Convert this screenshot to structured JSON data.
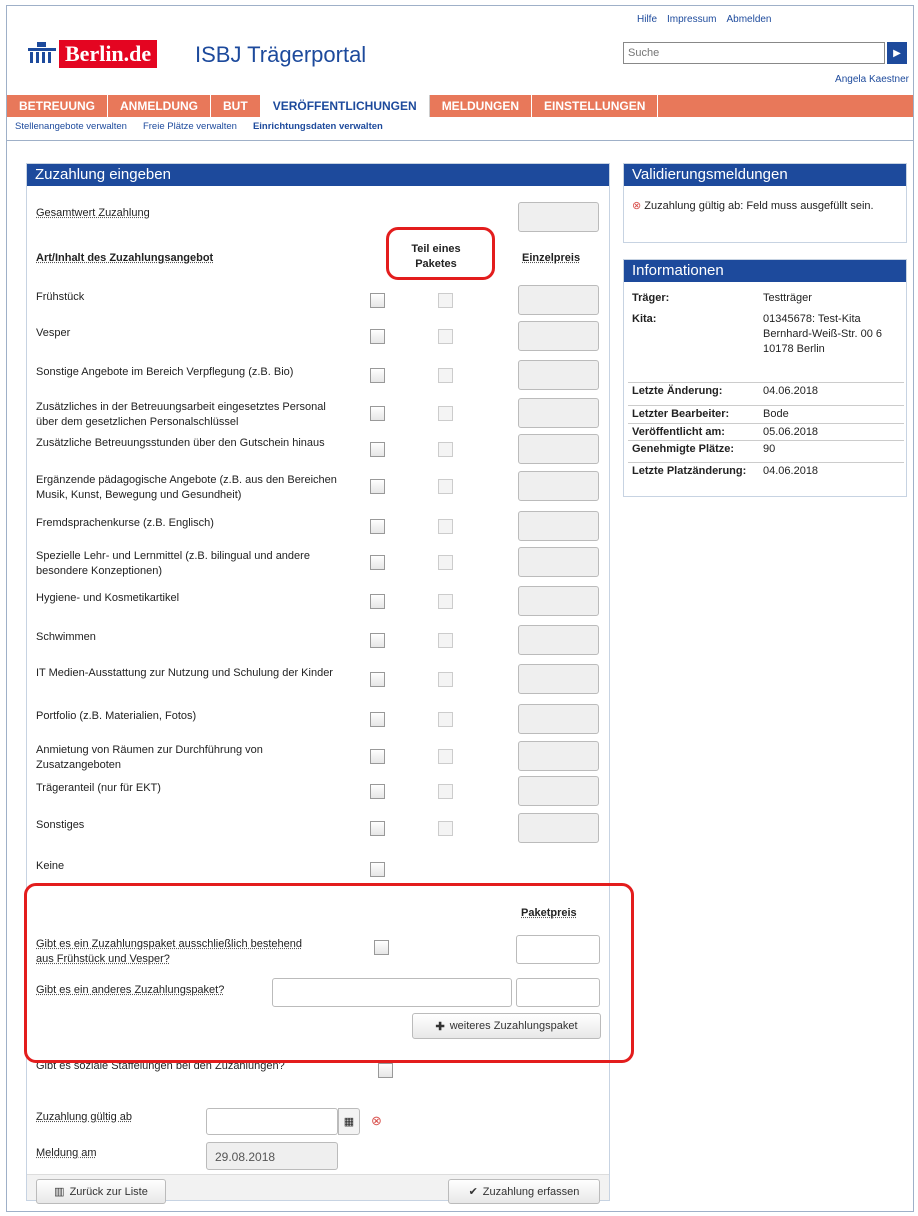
{
  "header": {
    "logo_text": "Berlin",
    "logo_de": ".de",
    "title": "ISBJ Trägerportal",
    "links": [
      "Hilfe",
      "Impressum",
      "Abmelden"
    ],
    "search_placeholder": "Suche",
    "user": "Angela Kaestner"
  },
  "nav": {
    "items": [
      "BETREUUNG",
      "ANMELDUNG",
      "BUT",
      "VERÖFFENTLICHUNGEN",
      "MELDUNGEN",
      "EINSTELLUNGEN"
    ],
    "active": "VERÖFFENTLICHUNGEN",
    "sub": [
      "Stellenangebote verwalten",
      "Freie Plätze verwalten",
      "Einrichtungsdaten verwalten"
    ]
  },
  "form": {
    "title": "Zuzahlung eingeben",
    "gesamtwert": "Gesamtwert Zuzahlung",
    "col_art": "Art/Inhalt des Zuzahlungsangebot",
    "col_teil": "Teil eines Paketes",
    "col_einzel": "Einzelpreis",
    "items": [
      "Frühstück",
      "Vesper",
      "Sonstige Angebote im Bereich Verpflegung (z.B. Bio)",
      "Zusätzliches in der Betreuungsarbeit eingesetztes Personal über dem gesetzlichen Personalschlüssel",
      "Zusätzliche Betreuungsstunden über den Gutschein hinaus",
      "Ergänzende pädagogische Angebote (z.B. aus den Bereichen Musik, Kunst, Bewegung und Gesundheit)",
      "Fremdsprachenkurse (z.B. Englisch)",
      "Spezielle Lehr- und Lernmittel (z.B. bilingual und andere besondere Konzeptionen)",
      "Hygiene- und Kosmetikartikel",
      "Schwimmen",
      "IT Medien-Ausstattung zur Nutzung und Schulung der Kinder",
      "Portfolio (z.B. Materialien, Fotos)",
      "Anmietung von Räumen zur Durchführung von Zusatzangeboten",
      "Trägeranteil (nur für EKT)",
      "Sonstiges",
      "Keine"
    ],
    "paketpreis": "Paketpreis",
    "paket_q1": "Gibt es ein Zuzahlungspaket ausschließlich bestehend aus Frühstück und Vesper?",
    "paket_q2": "Gibt es ein anderes Zuzahlungspaket?",
    "weiteres": "weiteres Zuzahlungspaket",
    "sozial": "Gibt es soziale Staffelungen bei den Zuzahlungen?",
    "gueltig": "Zuzahlung gültig ab",
    "meldung": "Meldung am",
    "meldung_value": "29.08.2018",
    "back": "Zurück zur Liste",
    "submit": "Zuzahlung erfassen"
  },
  "validation": {
    "title": "Validierungsmeldungen",
    "message": "Zuzahlung gültig ab: Feld muss ausgefüllt sein."
  },
  "info": {
    "title": "Informationen",
    "rows": [
      {
        "k": "Träger:",
        "v": "Testträger"
      },
      {
        "k": "Kita:",
        "v": "01345678: Test-Kita Bernhard-Weiß-Str. 00 6 10178 Berlin"
      },
      {
        "k": "Letzte Änderung:",
        "v": "04.06.2018"
      },
      {
        "k": "Letzter Bearbeiter:",
        "v": "Bode"
      },
      {
        "k": "Veröffentlicht am:",
        "v": "05.06.2018"
      },
      {
        "k": "Genehmigte Plätze:",
        "v": "90"
      },
      {
        "k": "Letzte Platzänderung:",
        "v": "04.06.2018"
      }
    ]
  },
  "colors": {
    "brand": "#1d4a9c",
    "nav": "#e8785a",
    "highlight": "#e31d1d"
  }
}
